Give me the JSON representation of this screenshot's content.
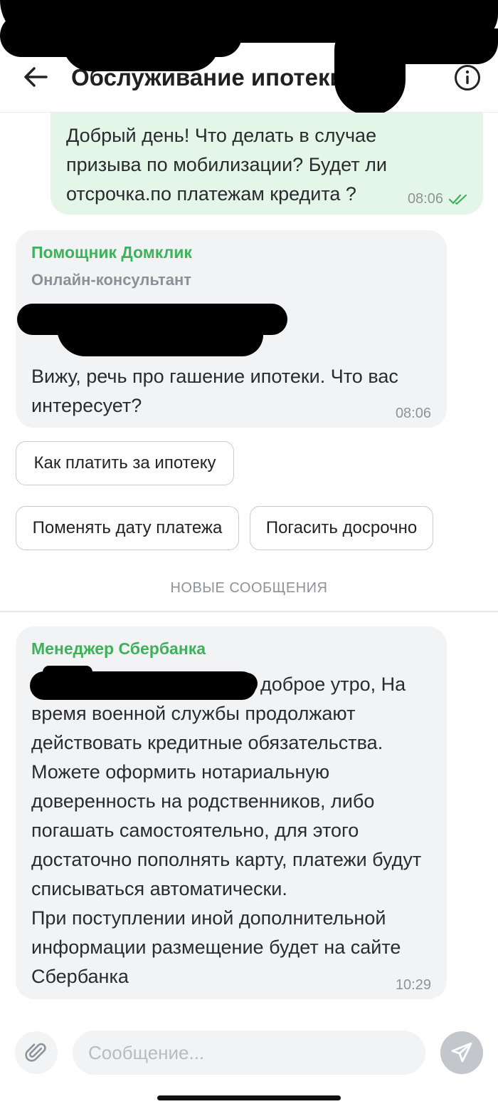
{
  "header": {
    "title": "Обслуживание ипотеки..."
  },
  "messages": {
    "outgoing": {
      "text": "Добрый день! Что делать в случае призыва по мобилизации? Будет ли отсрочка.по платежам кредита ?",
      "time": "08:06"
    },
    "assistant": {
      "sender": "Помощник Домклик",
      "role": "Онлайн-консультант",
      "text": "Вижу, речь про гашение ипотеки. Что вас интересует?",
      "time": "08:06"
    },
    "manager": {
      "sender": "Менеджер Сбербанка",
      "text_line1": "доброе утро, На",
      "text_rest": "время военной службы продолжают действовать кредитные обязательства. Можете оформить нотариальную доверенность на родственников, либо погашать самостоятельно, для этого достаточно пополнять карту, платежи будут списываться автоматически.",
      "text_end": "При поступлении иной дополнительной информации размещение будет на сайте Сбербанка",
      "time": "10:29"
    }
  },
  "quick_replies": [
    "Как платить за ипотеку",
    "Поменять дату платежа",
    "Погасить досрочно"
  ],
  "new_messages_label": "НОВЫЕ СООБЩЕНИЯ",
  "composer": {
    "placeholder": "Сообщение..."
  },
  "colors": {
    "accent_green": "#3fb15a",
    "outgoing_bubble": "#e3f6e7",
    "incoming_bubble": "#f2f3f5"
  },
  "icons": {
    "back": "arrow-left-icon",
    "info": "info-icon",
    "read": "double-check-icon",
    "attach": "paperclip-icon",
    "send": "send-icon"
  }
}
